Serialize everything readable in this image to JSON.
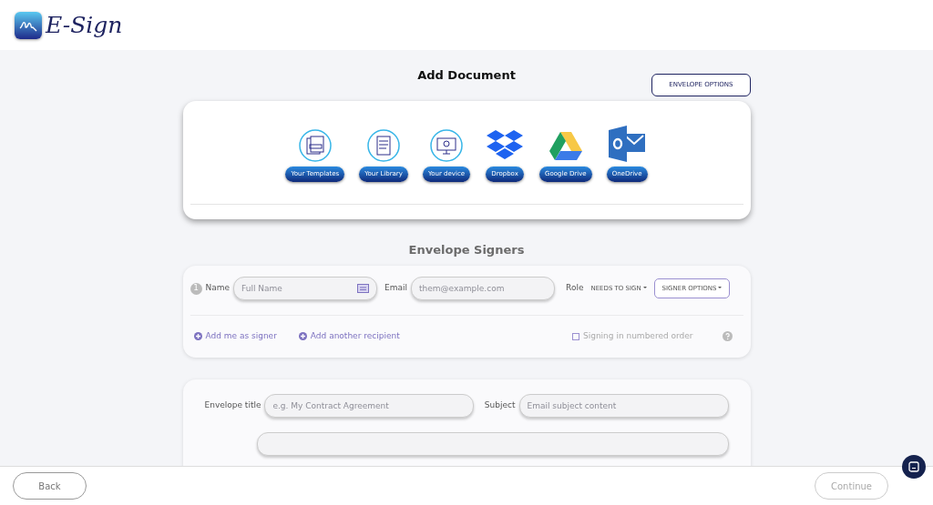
{
  "logo": {
    "text": "E-Sign"
  },
  "add_document": {
    "title": "Add Document",
    "options_button": "ENVELOPE OPTIONS",
    "sources": [
      {
        "kind": "templates",
        "label": "Your Templates"
      },
      {
        "kind": "library",
        "label": "Your Library"
      },
      {
        "kind": "device",
        "label": "Your device"
      },
      {
        "kind": "dropbox",
        "label": "Dropbox"
      },
      {
        "kind": "drive",
        "label": "Google Drive"
      },
      {
        "kind": "onedrive",
        "label": "OneDrive"
      }
    ]
  },
  "signers": {
    "title": "Envelope Signers",
    "rows": [
      {
        "number": "1",
        "name_label": "Name",
        "name_placeholder": "Full Name",
        "email_label": "Email",
        "email_placeholder": "them@example.com",
        "role_label": "Role",
        "role": "NEEDS TO SIGN",
        "options_button": "SIGNER OPTIONS"
      }
    ],
    "add_me": "Add me as signer",
    "add_recipient": "Add another recipient",
    "numbered_order": {
      "label": "Signing in numbered order",
      "checked": false
    }
  },
  "message": {
    "title_label": "Envelope title",
    "title_placeholder": "e.g. My Contract Agreement",
    "subject_label": "Subject",
    "subject_placeholder": "Email subject content"
  },
  "footer": {
    "back": "Back",
    "continue": {
      "label": "Continue",
      "disabled": true
    }
  }
}
